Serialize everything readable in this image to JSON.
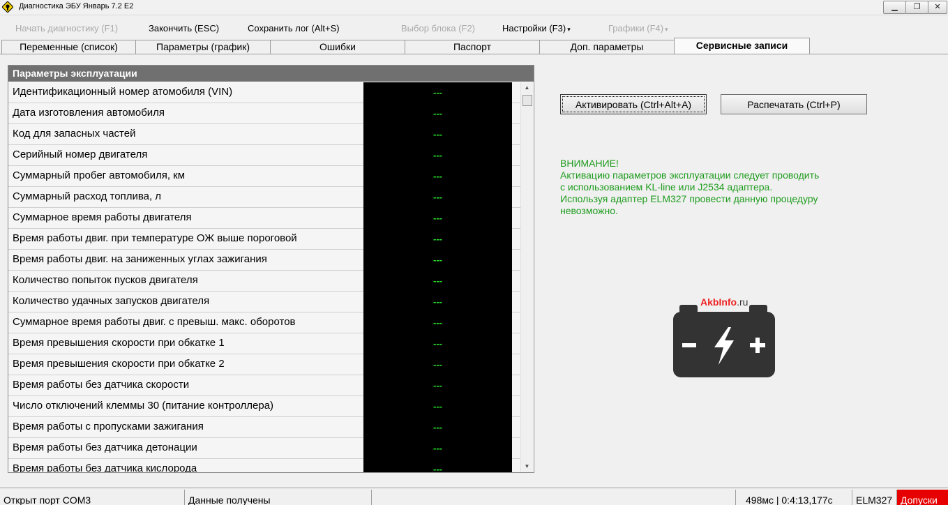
{
  "window": {
    "title": "Диагностика ЭБУ Январь 7.2 E2",
    "minimize": "▁",
    "restore": "❐",
    "close": "✕"
  },
  "toolbar": {
    "start": "Начать диагностику (F1)",
    "finish": "Закончить (ESC)",
    "save_log": "Сохранить лог (Alt+S)",
    "select_block": "Выбор блока (F2)",
    "settings": "Настройки (F3)",
    "charts": "Графики (F4)",
    "dropdown_arrow": "▾"
  },
  "tabs": [
    "Переменные (список)",
    "Параметры (график)",
    "Ошибки",
    "Паспорт",
    "Доп. параметры",
    "Сервисные записи"
  ],
  "active_tab": "Сервисные записи",
  "panel": {
    "header": "Параметры эксплуатации",
    "rows": [
      {
        "label": "Идентификационный номер атомобиля (VIN)",
        "value": "---"
      },
      {
        "label": "Дата изготовления автомобиля",
        "value": "---"
      },
      {
        "label": "Код для запасных частей",
        "value": "---"
      },
      {
        "label": "Серийный номер двигателя",
        "value": "---"
      },
      {
        "label": "Суммарный пробег автомобиля, км",
        "value": "---"
      },
      {
        "label": "Суммарный расход топлива, л",
        "value": "---"
      },
      {
        "label": "Суммарное время работы двигателя",
        "value": "---"
      },
      {
        "label": "Время работы двиг. при температуре ОЖ выше пороговой",
        "value": "---"
      },
      {
        "label": "Время работы двиг. на заниженных углах зажигания",
        "value": "---"
      },
      {
        "label": "Количество попыток пусков двигателя",
        "value": "---"
      },
      {
        "label": "Количество удачных запусков двигателя",
        "value": "---"
      },
      {
        "label": "Суммарное время работы двиг. с превыш. макс. оборотов",
        "value": "---"
      },
      {
        "label": "Время превышения скорости при обкатке 1",
        "value": "---"
      },
      {
        "label": "Время превышения скорости при обкатке 2",
        "value": "---"
      },
      {
        "label": "Время работы без датчика скорости",
        "value": "---"
      },
      {
        "label": "Число отключений клеммы 30 (питание контроллера)",
        "value": "---"
      },
      {
        "label": "Время работы с пропусками зажигания",
        "value": "---"
      },
      {
        "label": "Время работы без датчика детонации",
        "value": "---"
      },
      {
        "label": "Время работы без датчика кислорода",
        "value": "---"
      }
    ]
  },
  "buttons": {
    "activate": "Активировать (Ctrl+Alt+A)",
    "print": "Распечатать (Ctrl+P)"
  },
  "warning": {
    "title": "ВНИМАНИЕ!",
    "lines": [
      "Активацию параметров эксплуатации следует проводить",
      "с использованием KL-line или J2534 адаптера.",
      "Используя адаптер ELM327 провести данную процедуру",
      "невозможно."
    ],
    "color": "#1e9c1e"
  },
  "logo": {
    "brand": "AkbInfo",
    "tld": ".ru"
  },
  "statusbar": {
    "port": "Открыт порт COM3",
    "data": "Данные получены",
    "empty": "",
    "timing": "498мс | 0:4:13,177с",
    "adapter": "ELM327",
    "access": "Допуски",
    "access_color": "#e60000"
  }
}
